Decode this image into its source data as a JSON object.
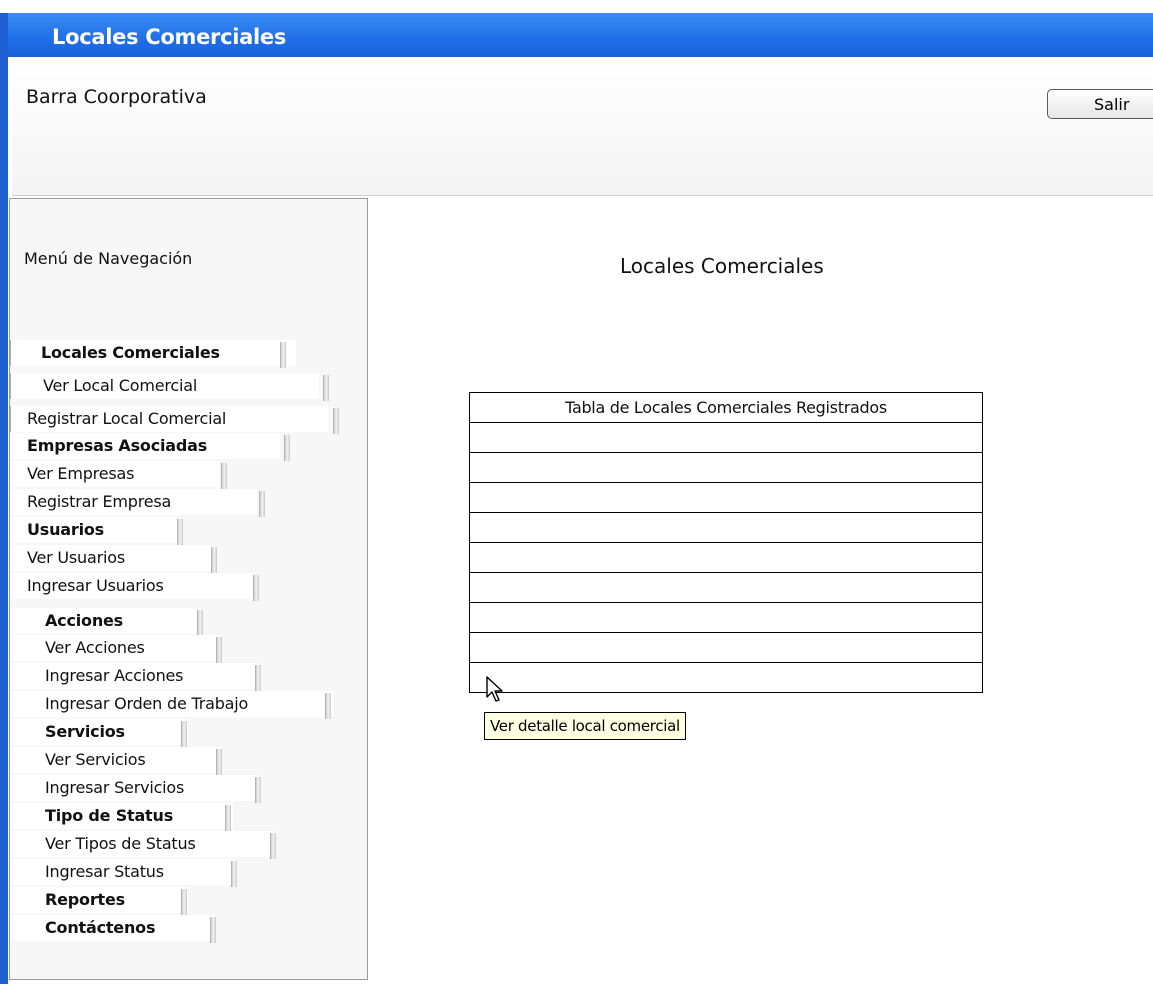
{
  "window": {
    "title": "Locales Comerciales"
  },
  "corp_bar": {
    "label": "Barra Coorporativa",
    "exit_label": "Salir"
  },
  "nav": {
    "title": "Menú de Navegación",
    "items": [
      {
        "label": "Locales Comerciales",
        "header": true
      },
      {
        "label": "Ver Local Comercial",
        "header": false
      },
      {
        "label": "Registrar Local Comercial",
        "header": false
      },
      {
        "label": "Empresas Asociadas",
        "header": true
      },
      {
        "label": "Ver Empresas",
        "header": false
      },
      {
        "label": "Registrar Empresa",
        "header": false
      },
      {
        "label": "Usuarios",
        "header": true
      },
      {
        "label": "Ver Usuarios",
        "header": false
      },
      {
        "label": "Ingresar Usuarios",
        "header": false
      },
      {
        "label": "Acciones",
        "header": true
      },
      {
        "label": "Ver Acciones",
        "header": false
      },
      {
        "label": "Ingresar Acciones",
        "header": false
      },
      {
        "label": "Ingresar Orden de Trabajo",
        "header": false
      },
      {
        "label": "Servicios",
        "header": true
      },
      {
        "label": "Ver Servicios",
        "header": false
      },
      {
        "label": "Ingresar Servicios",
        "header": false
      },
      {
        "label": "Tipo de Status",
        "header": true
      },
      {
        "label": "Ver Tipos de Status",
        "header": false
      },
      {
        "label": "Ingresar Status",
        "header": false
      },
      {
        "label": "Reportes",
        "header": true
      },
      {
        "label": "Contáctenos",
        "header": true
      }
    ]
  },
  "main": {
    "title": "Locales Comerciales",
    "table": {
      "header": "Tabla de Locales Comerciales Registrados",
      "rows": [
        "",
        "",
        "",
        "",
        "",
        "",
        "",
        "",
        ""
      ]
    },
    "tooltip": "Ver detalle local comercial"
  },
  "colors": {
    "title_bar": "#1f6ee8",
    "tooltip_bg": "#ffffe1"
  }
}
